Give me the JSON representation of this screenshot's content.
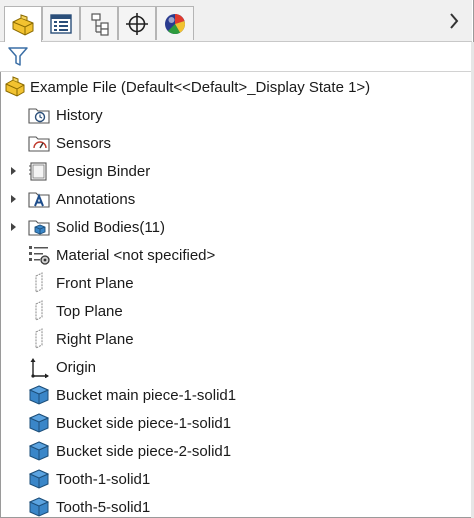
{
  "tabs": [
    {
      "name": "feature-manager",
      "icon": "part-icon"
    },
    {
      "name": "property-manager",
      "icon": "property-list-icon"
    },
    {
      "name": "configuration-manager",
      "icon": "configuration-tree-icon"
    },
    {
      "name": "dimxpert-manager",
      "icon": "crosshair-icon"
    },
    {
      "name": "display-manager",
      "icon": "color-sphere-icon"
    }
  ],
  "tree": {
    "root_label": "Example File  (Default<<Default>_Display State 1>)",
    "items": [
      {
        "label": "History",
        "icon": "history-folder-icon",
        "expandable": false
      },
      {
        "label": "Sensors",
        "icon": "sensors-folder-icon",
        "expandable": false
      },
      {
        "label": "Design Binder",
        "icon": "design-binder-icon",
        "expandable": true
      },
      {
        "label": "Annotations",
        "icon": "annotations-folder-icon",
        "expandable": true
      },
      {
        "label": "Solid Bodies(11)",
        "icon": "solid-bodies-folder-icon",
        "expandable": true
      },
      {
        "label": "Material <not specified>",
        "icon": "material-icon",
        "expandable": false
      },
      {
        "label": "Front Plane",
        "icon": "plane-icon",
        "expandable": false
      },
      {
        "label": "Top Plane",
        "icon": "plane-icon",
        "expandable": false
      },
      {
        "label": "Right Plane",
        "icon": "plane-icon",
        "expandable": false
      },
      {
        "label": "Origin",
        "icon": "origin-icon",
        "expandable": false
      },
      {
        "label": "Bucket main piece-1-solid1",
        "icon": "solid-body-icon",
        "expandable": false
      },
      {
        "label": "Bucket side piece-1-solid1",
        "icon": "solid-body-icon",
        "expandable": false
      },
      {
        "label": "Bucket side piece-2-solid1",
        "icon": "solid-body-icon",
        "expandable": false
      },
      {
        "label": "Tooth-1-solid1",
        "icon": "solid-body-icon",
        "expandable": false
      },
      {
        "label": "Tooth-5-solid1",
        "icon": "solid-body-icon",
        "expandable": false
      }
    ]
  },
  "colors": {
    "part_yellow": "#f2c230",
    "solid_blue": "#3a86c8",
    "tab_bg": "#f0f0f0"
  }
}
